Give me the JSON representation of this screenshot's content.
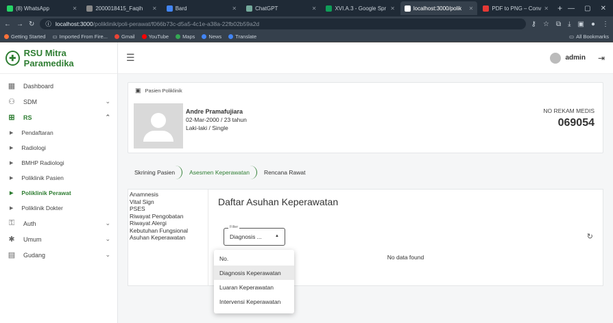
{
  "browser": {
    "tabs": [
      {
        "label": "(8) WhatsApp",
        "color": "#25d366"
      },
      {
        "label": "2000018415_Faqih",
        "color": "#888888"
      },
      {
        "label": "Bard",
        "color": "#4285f4"
      },
      {
        "label": "ChatGPT",
        "color": "#74aa9c"
      },
      {
        "label": "XVI.A.3 - Google Spr",
        "color": "#0f9d58"
      },
      {
        "label": "localhost:3000/polik",
        "color": "#ffffff",
        "active": true
      },
      {
        "label": "PDF to PNG – Conv",
        "color": "#e53935"
      }
    ],
    "url_host": "localhost:3000",
    "url_path": "/poliklinik/poli-perawat/f066b73c-d5a5-4c1e-a38a-22fb02b59a2d",
    "bookmarks": [
      "Getting Started",
      "Imported From Fire...",
      "Gmail",
      "YouTube",
      "Maps",
      "News",
      "Translate"
    ],
    "bookmarks_right": "All Bookmarks"
  },
  "brand": {
    "name": "RSU Mitra Paramedika",
    "color": "#2e7d32"
  },
  "sidebar": {
    "dashboard": "Dashboard",
    "sdm": "SDM",
    "rs": "RS",
    "sub": [
      "Pendaftaran",
      "Radiologi",
      "BMHP Radiologi",
      "Poliklinik Pasien",
      "Poliklinik Perawat",
      "Poliklinik Dokter"
    ],
    "auth": "Auth",
    "umum": "Umum",
    "gudang": "Gudang"
  },
  "topbar": {
    "user": "admin"
  },
  "patient_card": {
    "header": "Pasien Poliklinik",
    "name": "Andre Pramafujiara",
    "dob": "02-Mar-2000 / 23 tahun",
    "gender": "Laki-laki / Single",
    "rm_label": "NO REKAM MEDIS",
    "rm_number": "069054"
  },
  "steps": [
    "Skrining Pasien",
    "Asesmen Keperawatan",
    "Rencana Rawat"
  ],
  "subnav": [
    "Anamnesis",
    "Vital Sign",
    "PSES",
    "Riwayat Pengobatan",
    "Riwayat Alergi",
    "Kebutuhan Fungsional",
    "Asuhan Keperawatan"
  ],
  "content": {
    "title": "Daftar Asuhan Keperawatan",
    "filter_label": "Filter",
    "filter_value": "Diagnosis ...",
    "no_data": "No data found"
  },
  "dropdown": [
    "No.",
    "Diagnosis Keperawatan",
    "Luaran Keperawatan",
    "Intervensi Keperawatan"
  ]
}
